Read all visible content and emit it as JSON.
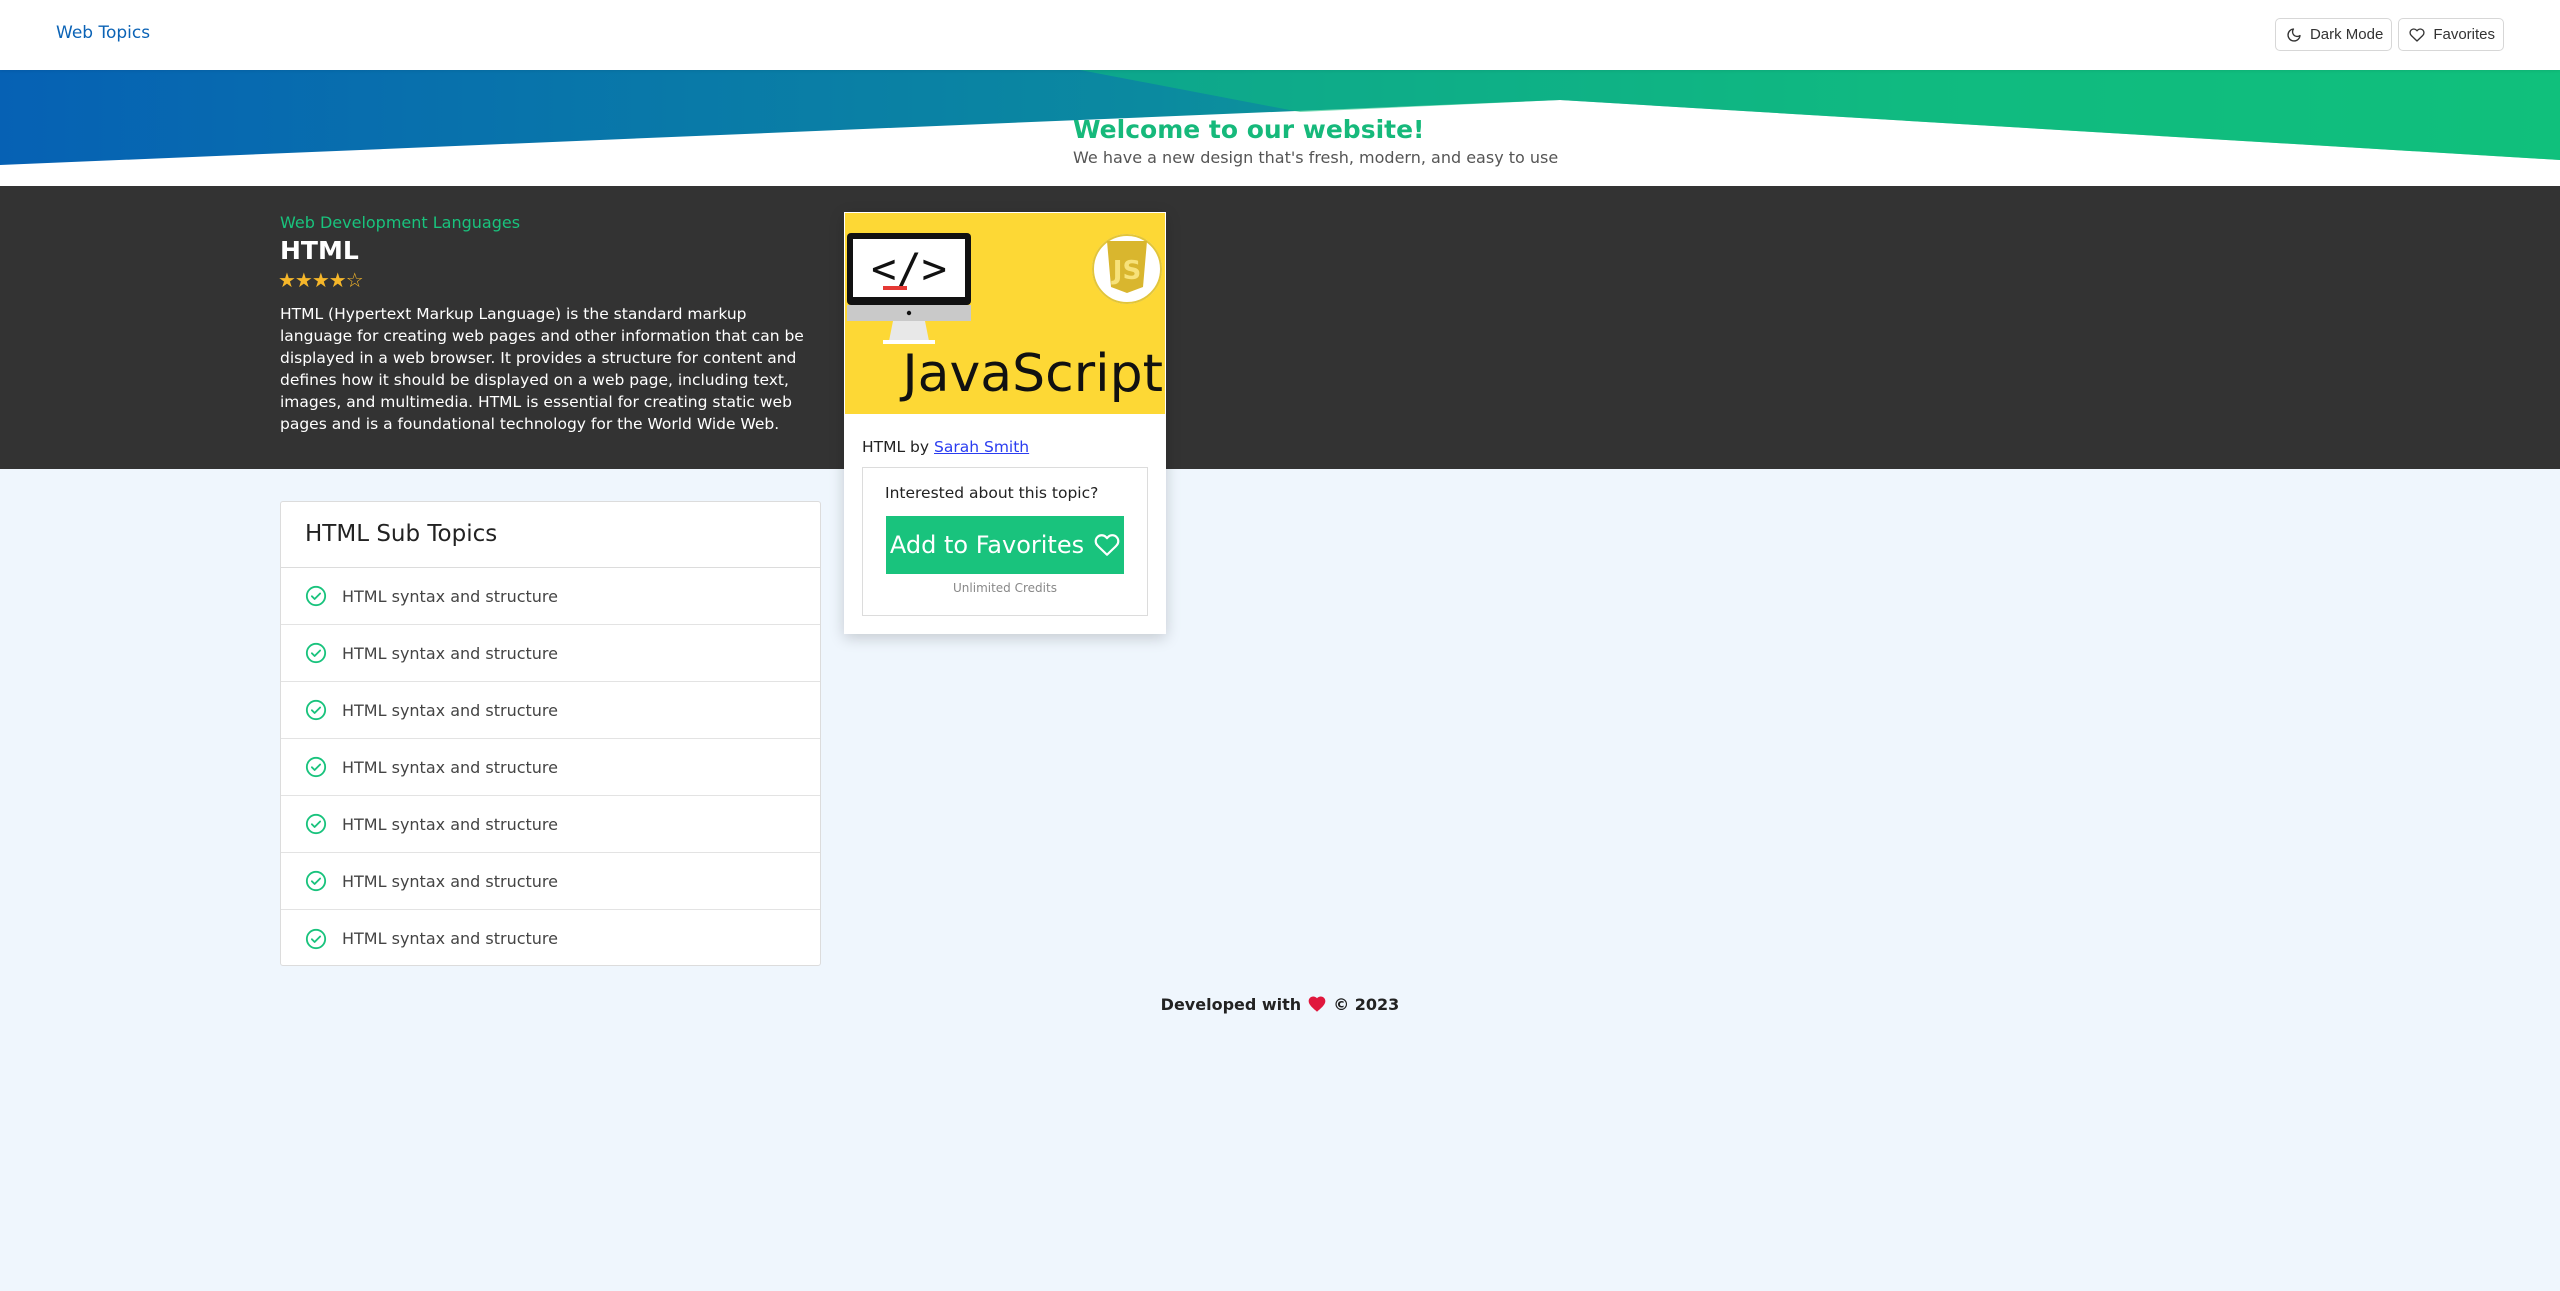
{
  "header": {
    "brand": "Web Topics",
    "dark_mode_label": "Dark Mode",
    "favorites_label": "Favorites"
  },
  "banner": {
    "title": "Welcome to our website!",
    "subtitle": "We have a new design that's fresh, modern, and easy to use"
  },
  "topic": {
    "category": "Web Development Languages",
    "title": "HTML",
    "rating": 4,
    "rating_max": 5,
    "stars_text": "★★★★☆",
    "description": "HTML (Hypertext Markup Language) is the standard markup language for creating web pages and other information that can be displayed in a web browser. It provides a structure for content and defines how it should be displayed on a web page, including text, images, and multimedia. HTML is essential for creating static web pages and is a foundational technology for the World Wide Web."
  },
  "card": {
    "image_text": "JavaScript",
    "image_badge": "JS",
    "image_code_glyph": "</>",
    "author_prefix": "HTML by",
    "author_name": "Sarah Smith",
    "cta_question": "Interested about this topic?",
    "cta_button": "Add to Favorites",
    "cta_note": "Unlimited Credits"
  },
  "subtopics": {
    "heading": "HTML Sub Topics",
    "items": [
      "HTML syntax and structure",
      "HTML syntax and structure",
      "HTML syntax and structure",
      "HTML syntax and structure",
      "HTML syntax and structure",
      "HTML syntax and structure",
      "HTML syntax and structure"
    ]
  },
  "footer": {
    "prefix": "Developed with",
    "suffix": "© 2023"
  },
  "colors": {
    "accent_green": "#19c37d",
    "brand_blue": "#0b63b6",
    "dark_section": "#333333",
    "star": "#f6b72a",
    "heart": "#e0173d",
    "js_yellow": "#fdd835"
  },
  "icons": {
    "dark_mode": "moon-icon",
    "favorites": "heart-outline-icon",
    "subtopic_check": "check-circle-icon",
    "footer_heart": "heart-filled-icon"
  }
}
